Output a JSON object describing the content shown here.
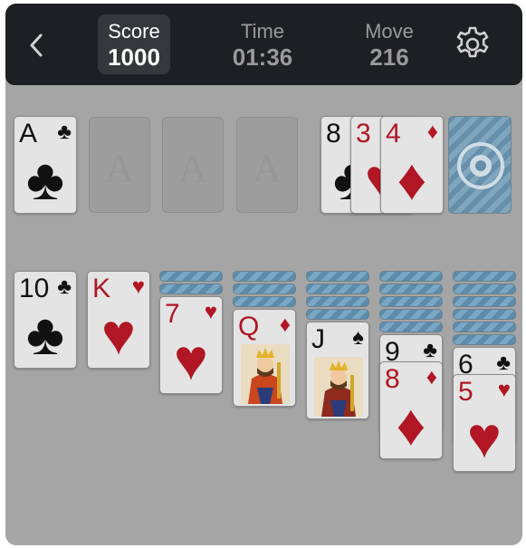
{
  "header": {
    "score_label": "Score",
    "score_value": "1000",
    "time_label": "Time",
    "time_value": "01:36",
    "move_label": "Move",
    "move_value": "216"
  },
  "foundations": [
    {
      "rank": "A",
      "suit": "♣",
      "color": "black"
    },
    {
      "empty": true,
      "placeholder": "A"
    },
    {
      "empty": true,
      "placeholder": "A"
    },
    {
      "empty": true,
      "placeholder": "A"
    }
  ],
  "waste": [
    {
      "rank": "8",
      "suit": "♣",
      "color": "black"
    },
    {
      "rank": "3",
      "suit": "♥",
      "color": "red"
    },
    {
      "rank": "4",
      "suit": "♦",
      "color": "red"
    }
  ],
  "tableau": [
    {
      "hidden": 0,
      "cards": [
        {
          "rank": "10",
          "suit": "♣",
          "color": "black"
        }
      ]
    },
    {
      "hidden": 0,
      "cards": [
        {
          "rank": "K",
          "suit": "♥",
          "color": "red"
        }
      ]
    },
    {
      "hidden": 2,
      "cards": [
        {
          "rank": "7",
          "suit": "♥",
          "color": "red"
        }
      ]
    },
    {
      "hidden": 3,
      "cards": [
        {
          "rank": "Q",
          "suit": "♦",
          "color": "red",
          "face": "queen"
        }
      ]
    },
    {
      "hidden": 4,
      "cards": [
        {
          "rank": "J",
          "suit": "♠",
          "color": "black",
          "face": "jack"
        }
      ]
    },
    {
      "hidden": 5,
      "cards": [
        {
          "rank": "9",
          "suit": "♣",
          "color": "black"
        },
        {
          "rank": "8",
          "suit": "♦",
          "color": "red"
        }
      ]
    },
    {
      "hidden": 6,
      "cards": [
        {
          "rank": "6",
          "suit": "♣",
          "color": "black"
        },
        {
          "rank": "5",
          "suit": "♥",
          "color": "red"
        }
      ]
    }
  ],
  "colors": {
    "red_suit": "#b01623",
    "black_suit": "#111111",
    "card_back": "#5b8cab",
    "topbar": "#1d1f22"
  }
}
